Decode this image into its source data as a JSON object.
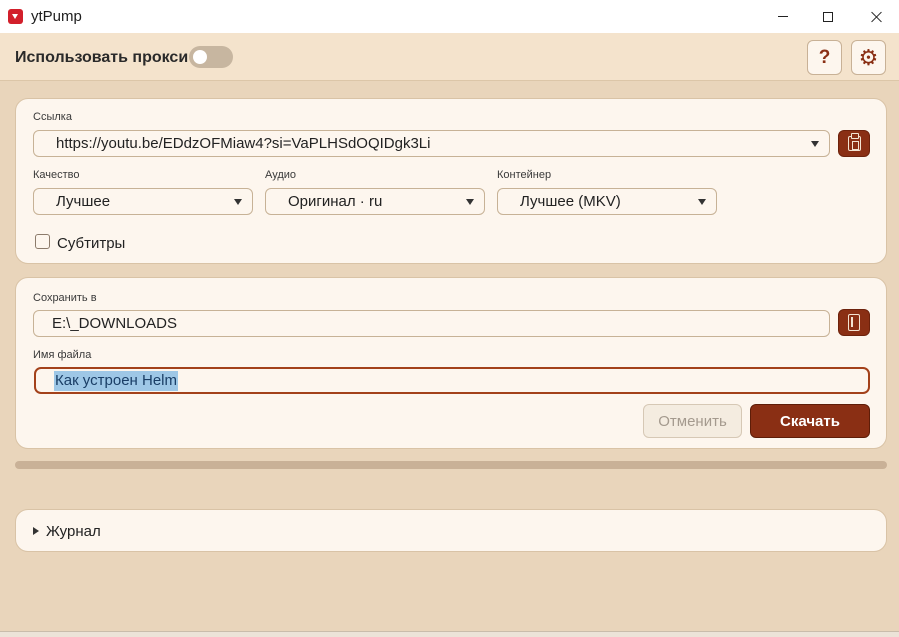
{
  "window": {
    "title": "ytPump",
    "icon": "youtube-play-icon"
  },
  "topbar": {
    "proxy_label": "Использовать прокси",
    "proxy_enabled": false,
    "help_glyph": "?",
    "settings_glyph": "⚙"
  },
  "link_card": {
    "url_label": "Ссылка",
    "url_value": "https://youtu.be/EDdzOFMiaw4?si=VaPLHSdOQIDgk3Li",
    "quality_label": "Качество",
    "quality_value": "Лучшее",
    "audio_label": "Аудио",
    "audio_value": "Оригинал · ru",
    "container_label": "Контейнер",
    "container_value": "Лучшее (MKV)",
    "subtitles_label": "Субтитры",
    "subtitles_checked": false
  },
  "save_card": {
    "save_label": "Сохранить в",
    "save_path": "E:\\_DOWNLOADS",
    "filename_label": "Имя файла",
    "filename_value": "Как устроен Helm",
    "cancel_label": "Отменить",
    "download_label": "Скачать"
  },
  "progress": {
    "value": 0
  },
  "log": {
    "label": "Журнал",
    "expanded": false
  },
  "colors": {
    "accent": "#8a2f14",
    "background": "#e9d5bb",
    "card": "#fdf6ee"
  }
}
